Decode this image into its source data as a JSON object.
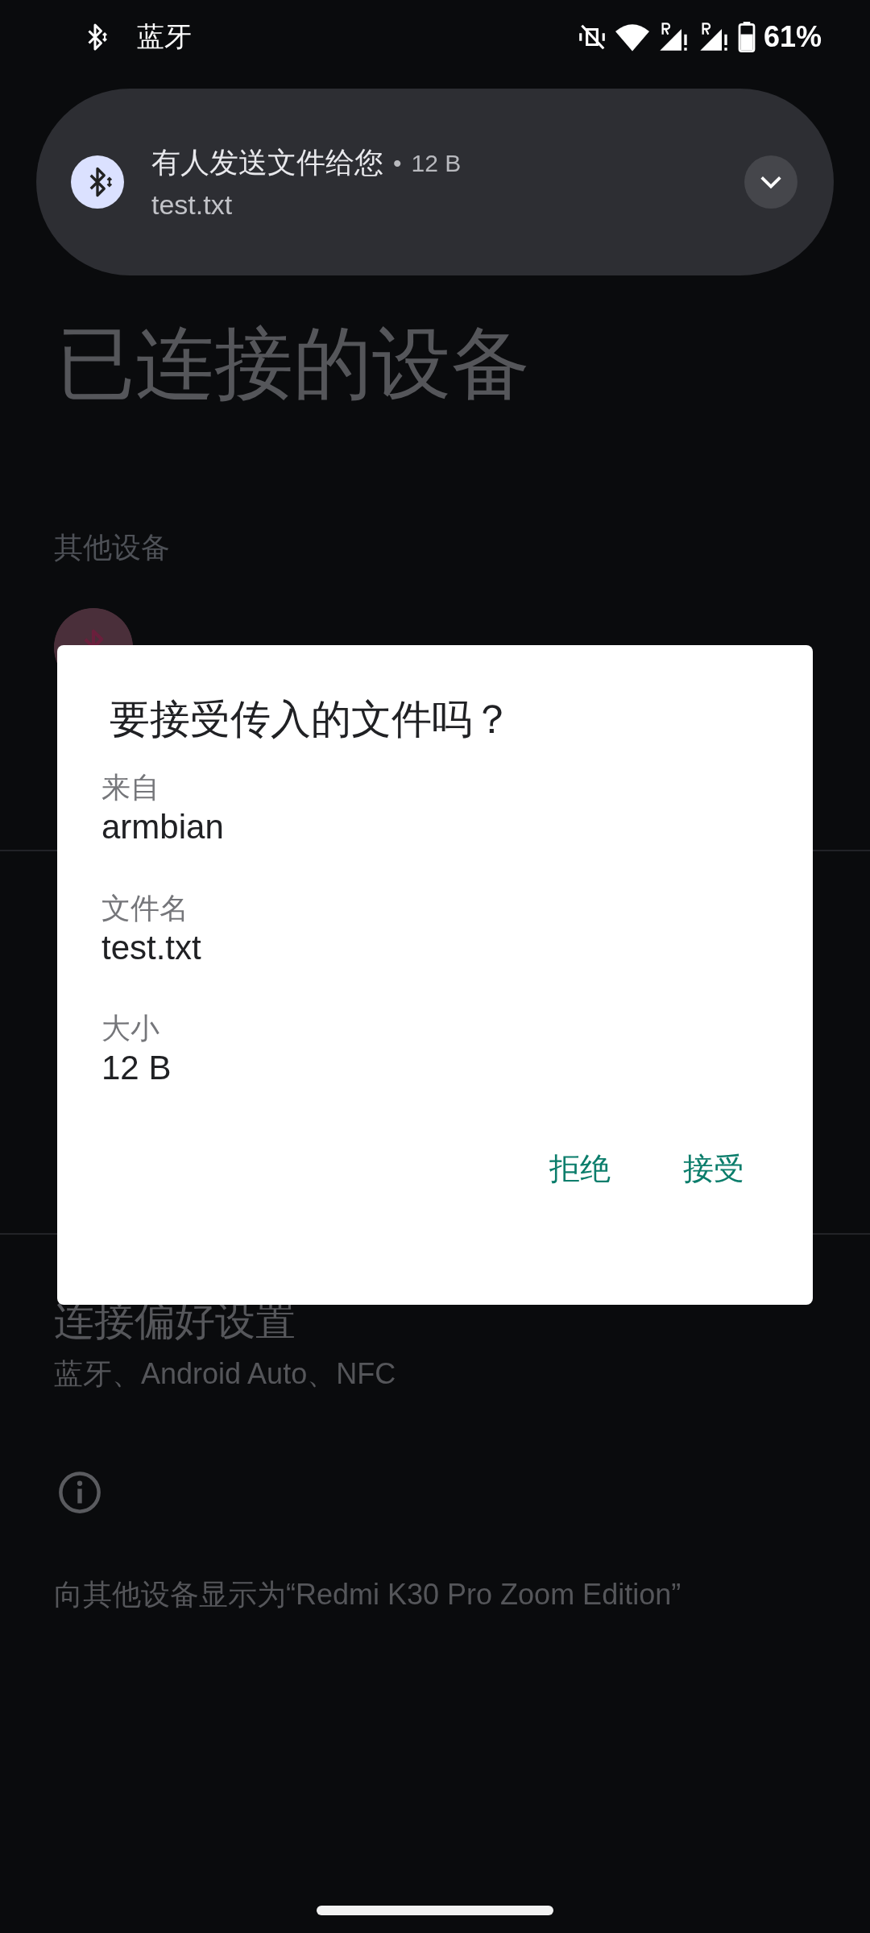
{
  "status_bar": {
    "label": "蓝牙",
    "battery": "61%"
  },
  "notification": {
    "title": "有人发送文件给您",
    "separator": "•",
    "size": "12 B",
    "file": "test.txt"
  },
  "page": {
    "title": "已连接的设备",
    "section": "其他设备",
    "preferences": {
      "title": "连接偏好设置",
      "subtitle": "蓝牙、Android Auto、NFC"
    },
    "footer": "向其他设备显示为“Redmi K30 Pro Zoom Edition”"
  },
  "dialog": {
    "title": "要接受传入的文件吗？",
    "fields": [
      {
        "label": "来自",
        "value": "armbian"
      },
      {
        "label": "文件名",
        "value": "test.txt"
      },
      {
        "label": "大小",
        "value": "12 B"
      }
    ],
    "buttons": [
      "拒绝",
      "接受"
    ]
  }
}
